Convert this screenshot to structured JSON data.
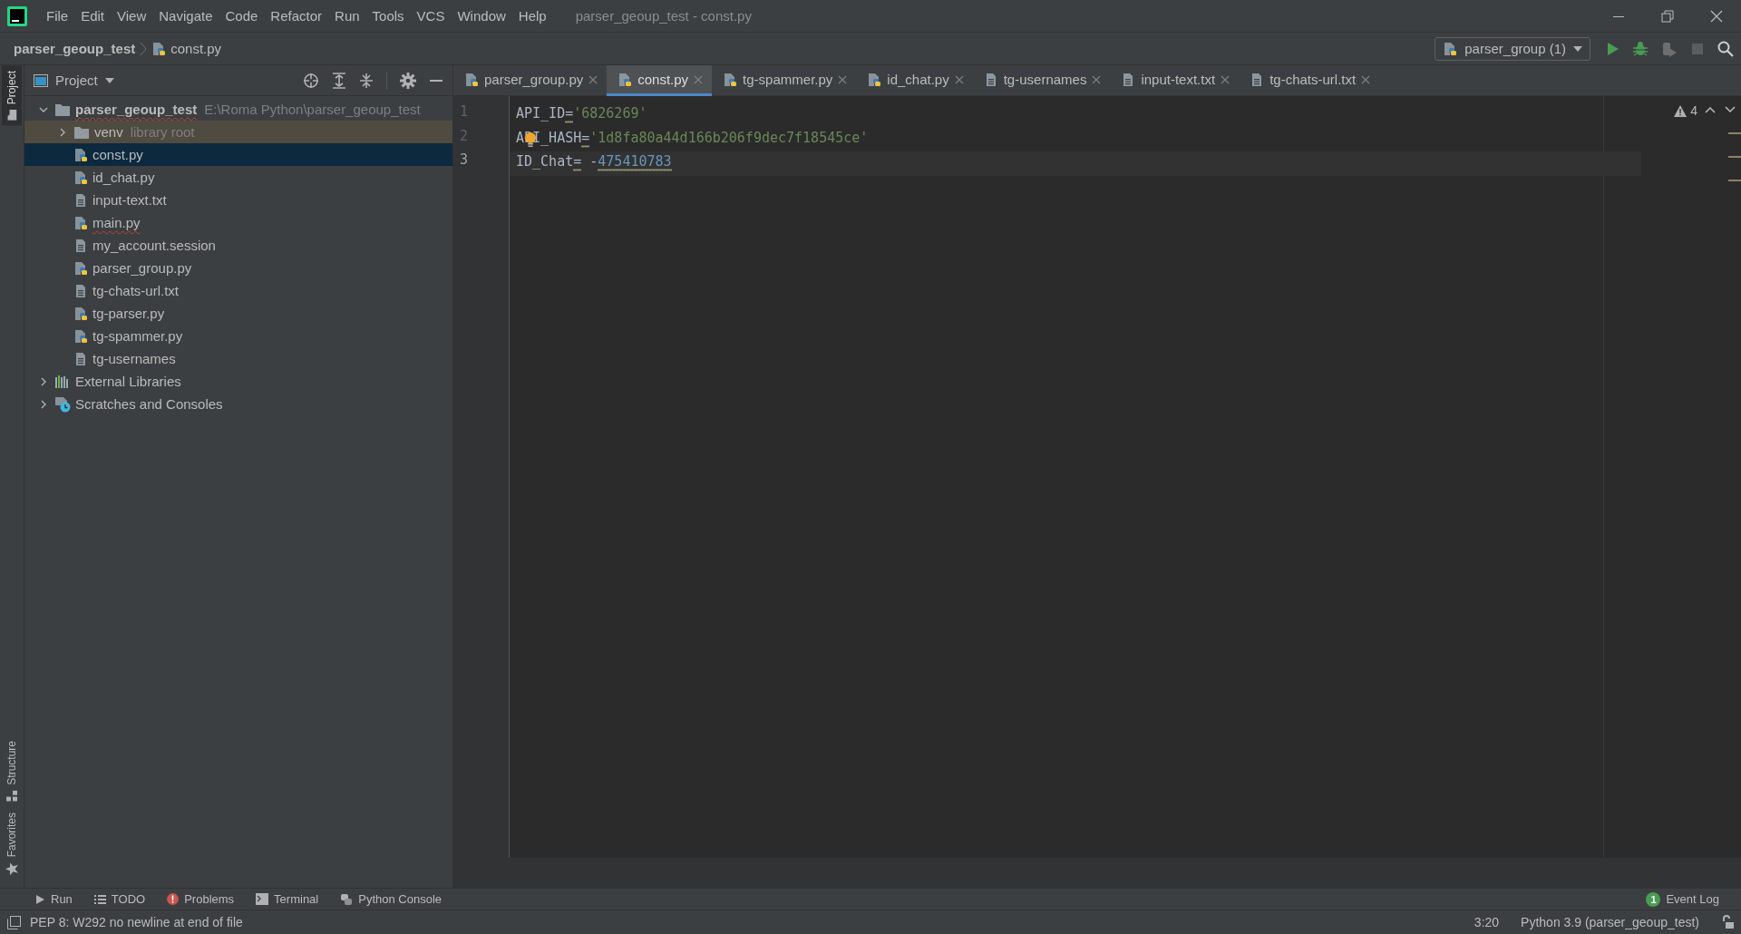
{
  "window": {
    "title": "parser_geoup_test - const.py"
  },
  "menu": [
    "File",
    "Edit",
    "View",
    "Navigate",
    "Code",
    "Refactor",
    "Run",
    "Tools",
    "VCS",
    "Window",
    "Help"
  ],
  "breadcrumbs": [
    {
      "label": "parser_geoup_test",
      "kind": "project"
    },
    {
      "label": "const.py",
      "kind": "python"
    }
  ],
  "run_config": {
    "label": "parser_group (1)"
  },
  "side_tabs": [
    {
      "label": "Project",
      "kind": "project",
      "selected": true
    },
    {
      "label": "Structure",
      "kind": "structure",
      "selected": false
    },
    {
      "label": "Favorites",
      "kind": "favorites",
      "selected": false
    }
  ],
  "project_panel": {
    "title": "Project",
    "tree": [
      {
        "label": "parser_geoup_test",
        "hint": "E:\\Roma Python\\parser_geoup_test",
        "kind": "root",
        "expanded": true,
        "selected": false,
        "highlighted": false,
        "error": true,
        "children": [
          {
            "label": "venv",
            "hint": "library root",
            "kind": "folder",
            "expanded": false,
            "selected": false,
            "highlighted": true,
            "error": false
          },
          {
            "label": "const.py",
            "kind": "python",
            "selected": true,
            "highlighted": false,
            "error": false
          },
          {
            "label": "id_chat.py",
            "kind": "python",
            "selected": false,
            "highlighted": false,
            "error": false
          },
          {
            "label": "input-text.txt",
            "kind": "text",
            "selected": false,
            "highlighted": false,
            "error": false
          },
          {
            "label": "main.py",
            "kind": "python",
            "selected": false,
            "highlighted": false,
            "error": true
          },
          {
            "label": "my_account.session",
            "kind": "text",
            "selected": false,
            "highlighted": false,
            "error": false
          },
          {
            "label": "parser_group.py",
            "kind": "python",
            "selected": false,
            "highlighted": false,
            "error": false
          },
          {
            "label": "tg-chats-url.txt",
            "kind": "text",
            "selected": false,
            "highlighted": false,
            "error": false
          },
          {
            "label": "tg-parser.py",
            "kind": "python",
            "selected": false,
            "highlighted": false,
            "error": false
          },
          {
            "label": "tg-spammer.py",
            "kind": "python",
            "selected": false,
            "highlighted": false,
            "error": false
          },
          {
            "label": "tg-usernames",
            "kind": "text",
            "selected": false,
            "highlighted": false,
            "error": false
          }
        ]
      },
      {
        "label": "External Libraries",
        "kind": "libraries",
        "expanded": false,
        "selected": false,
        "highlighted": false,
        "error": false
      },
      {
        "label": "Scratches and Consoles",
        "kind": "scratches",
        "expanded": false,
        "selected": false,
        "highlighted": false,
        "error": false
      }
    ]
  },
  "tabs": [
    {
      "label": "parser_group.py",
      "kind": "python",
      "selected": false
    },
    {
      "label": "const.py",
      "kind": "python",
      "selected": true
    },
    {
      "label": "tg-spammer.py",
      "kind": "python",
      "selected": false
    },
    {
      "label": "id_chat.py",
      "kind": "python",
      "selected": false
    },
    {
      "label": "tg-usernames",
      "kind": "text",
      "selected": false
    },
    {
      "label": "input-text.txt",
      "kind": "text",
      "selected": false
    },
    {
      "label": "tg-chats-url.txt",
      "kind": "text",
      "selected": false
    }
  ],
  "editor": {
    "warnings": "4",
    "lines": [
      {
        "number": "1",
        "current": false,
        "bulb": false,
        "tokens": [
          {
            "text": "API_ID",
            "kind": "ident",
            "warn": false
          },
          {
            "text": "=",
            "kind": "op",
            "warn": true
          },
          {
            "text": "'6826269'",
            "kind": "string",
            "warn": false
          }
        ]
      },
      {
        "number": "2",
        "current": false,
        "bulb": true,
        "tokens": [
          {
            "text": "API_HASH",
            "kind": "ident",
            "warn": false
          },
          {
            "text": "=",
            "kind": "op",
            "warn": true
          },
          {
            "text": "'1d8fa80a44d166b206f9dec7f18545ce'",
            "kind": "string",
            "warn": false
          }
        ]
      },
      {
        "number": "3",
        "current": true,
        "bulb": false,
        "tokens": [
          {
            "text": "ID_Chat",
            "kind": "ident",
            "warn": false
          },
          {
            "text": "=",
            "kind": "op",
            "warn": true
          },
          {
            "text": " -",
            "kind": "op",
            "warn": false
          },
          {
            "text": "475410783",
            "kind": "number",
            "warn": true
          }
        ]
      }
    ]
  },
  "tool_windows": [
    {
      "label": "Run",
      "kind": "run"
    },
    {
      "label": "TODO",
      "kind": "todo"
    },
    {
      "label": "Problems",
      "kind": "problems"
    },
    {
      "label": "Terminal",
      "kind": "terminal"
    },
    {
      "label": "Python Console",
      "kind": "console"
    }
  ],
  "event_log": {
    "label": "Event Log",
    "count": "1"
  },
  "status_bar": {
    "message": "PEP 8: W292 no newline at end of file",
    "position": "3:20",
    "interpreter": "Python 3.9 (parser_geoup_test)"
  }
}
